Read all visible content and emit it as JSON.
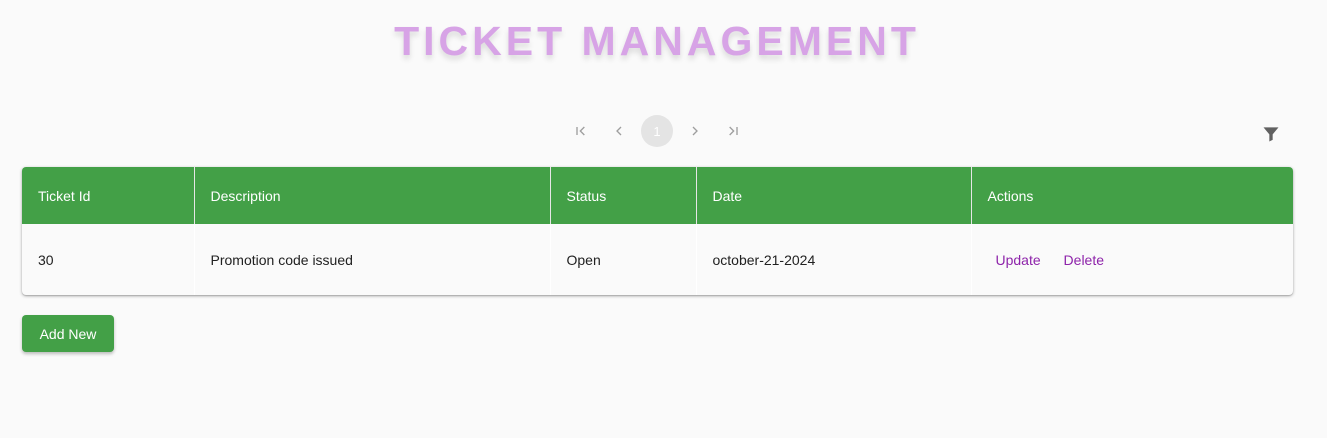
{
  "header": {
    "title": "TICKET MANAGEMENT",
    "title_color": "#d7a3e6"
  },
  "pagination": {
    "current_page": "1",
    "icons": [
      "first-page-icon",
      "previous-page-icon",
      "next-page-icon",
      "last-page-icon"
    ]
  },
  "toolbar": {
    "filter_icon": "filter-icon"
  },
  "table": {
    "header_color": "#43a047",
    "columns": [
      "Ticket Id",
      "Description",
      "Status",
      "Date",
      "Actions"
    ],
    "rows": [
      {
        "ticket_id": "30",
        "description": "Promotion code issued",
        "status": "Open",
        "date": "october-21-2024",
        "actions": {
          "update_label": "Update",
          "delete_label": "Delete"
        }
      }
    ]
  },
  "actions": {
    "add_new_label": "Add New"
  },
  "colors": {
    "accent_green": "#43a047",
    "action_purple": "#8e24aa"
  }
}
